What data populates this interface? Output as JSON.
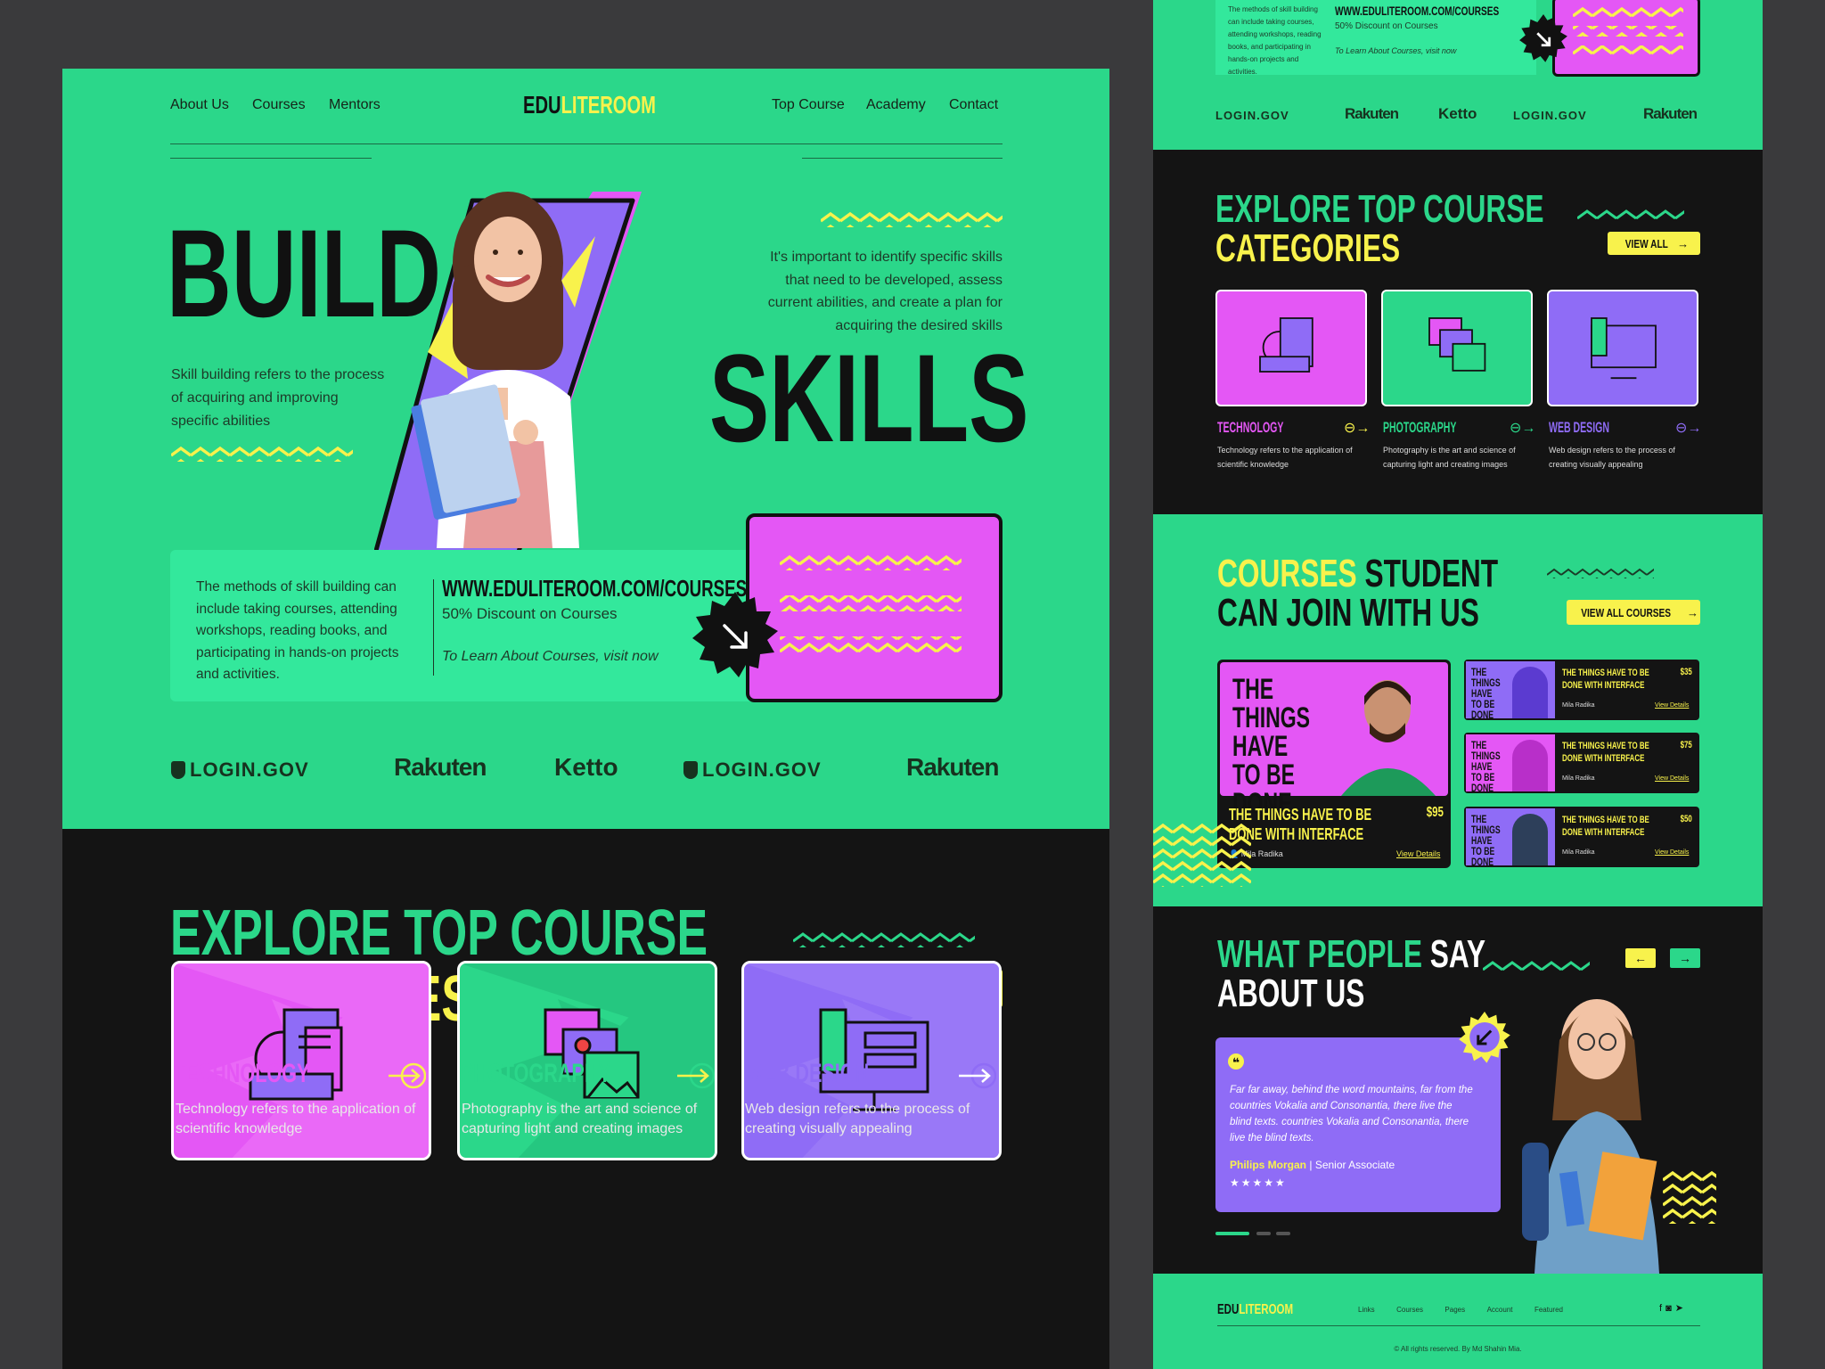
{
  "brand": {
    "edu": "EDU",
    "literoom": "LITEROOM"
  },
  "nav": {
    "left": [
      "About Us",
      "Courses",
      "Mentors"
    ],
    "right": [
      "Top Course",
      "Academy",
      "Contact"
    ]
  },
  "hero": {
    "title_left": "BUILD",
    "title_right": "SKILLS",
    "left_desc": "Skill building refers to the process of acquiring and improving specific abilities",
    "right_desc": "It's important to identify specific skills that need to be developed, assess current abilities, and create a plan for acquiring the desired skills"
  },
  "promo": {
    "desc": "The methods of skill building can include taking courses, attending workshops, reading books, and participating in hands-on projects and activities.",
    "url": "WWW.EDULITEROOM.COM/COURSES",
    "discount": "50% Discount on Courses",
    "cta": "To Learn About Courses, visit now"
  },
  "logos": [
    "LOGIN.GOV",
    "Rakuten",
    "Ketto",
    "LOGIN.GOV",
    "Rakuten"
  ],
  "categories": {
    "title_line1": "EXPLORE TOP COURSE",
    "title_line2": "CATEGORIES",
    "view_all": "VIEW ALL",
    "items": [
      {
        "title": "TECHNOLOGY",
        "desc": "Technology refers to the application of scientific knowledge",
        "color": "#e457f5"
      },
      {
        "title": "PHOTOGRAPHY",
        "desc": "Photography is the art and science of capturing light and creating images",
        "color": "#2bd78a"
      },
      {
        "title": "WEB DESIGN",
        "desc": "Web design refers to the process of creating visually appealing",
        "color": "#8f6cf6"
      }
    ]
  },
  "courses": {
    "title_hl": "COURSES",
    "title_rest": "STUDENT",
    "title_line2": "CAN JOIN WITH US",
    "view_all": "VIEW ALL COURSES",
    "featured": {
      "thumb": "THE THINGS HAVE TO BE DONE",
      "title": "THE THINGS HAVE TO BE DONE WITH INTERFACE",
      "price": "$95",
      "author": "Mila Radika",
      "link": "View Details"
    },
    "list": [
      {
        "thumb": "THE THINGS HAVE TO BE DONE",
        "title": "THE THINGS HAVE TO BE DONE WITH INTERFACE",
        "price": "$35",
        "author": "Mila Radika",
        "link": "View Details"
      },
      {
        "thumb": "THE THINGS HAVE TO BE DONE",
        "title": "THE THINGS HAVE TO BE DONE WITH INTERFACE",
        "price": "$75",
        "author": "Mila Radika",
        "link": "View Details"
      },
      {
        "thumb": "THE THINGS HAVE TO BE DONE",
        "title": "THE THINGS HAVE TO BE DONE WITH INTERFACE",
        "price": "$50",
        "author": "Mila Radika",
        "link": "View Details"
      }
    ]
  },
  "testimonials": {
    "title_hl": "WHAT PEOPLE",
    "title_rest": "SAY",
    "title_line2": "ABOUT US",
    "quote": "Far far away, behind the word mountains, far from the countries Vokalia and Consonantia, there live the blind texts. countries Vokalia and Consonantia, there live the blind texts.",
    "name": "Philips Morgan",
    "role": "Senior Associate",
    "stars": "★★★★★"
  },
  "footer": {
    "links": [
      "Links",
      "Courses",
      "Pages",
      "Account",
      "Featured"
    ],
    "copyright": "© All rights reserved. By Md Shahin Mia."
  },
  "colors": {
    "green": "#2bd78a",
    "pink": "#e457f5",
    "purple": "#8f6cf6",
    "yellow": "#f8f24c",
    "dark": "#141414"
  }
}
